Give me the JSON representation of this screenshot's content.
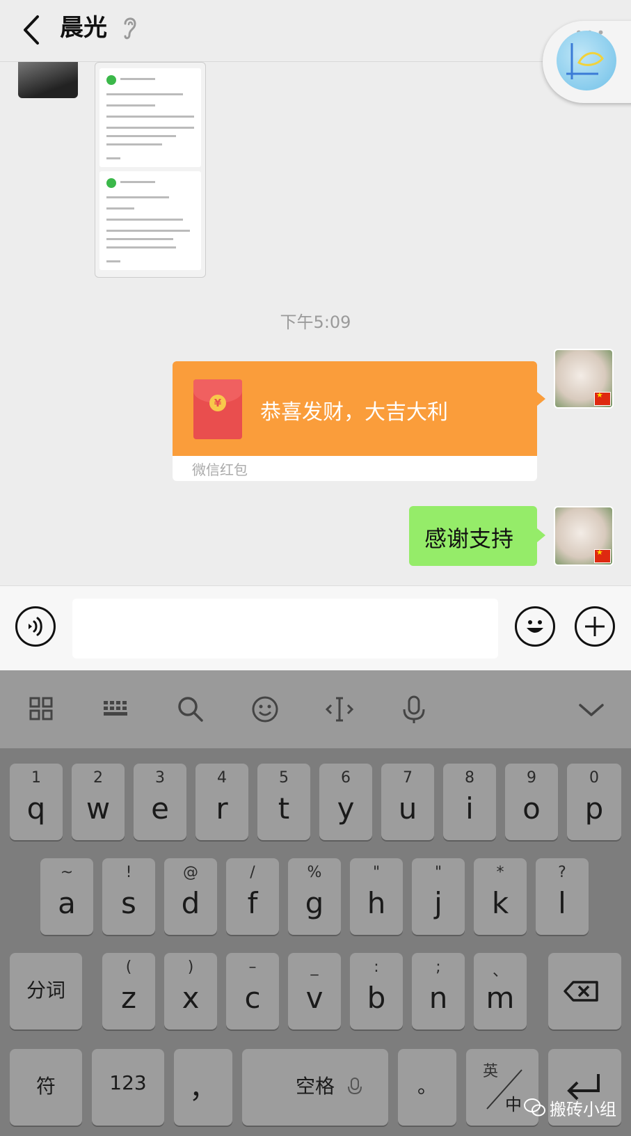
{
  "header": {
    "title": "晨光"
  },
  "chat": {
    "timestamp": "下午5:09",
    "red_packet": {
      "greeting": "恭喜发财，大吉大利",
      "label": "微信红包",
      "coin": "¥"
    },
    "text_message": "感谢支持"
  },
  "input": {
    "value": "",
    "placeholder": ""
  },
  "keyboard": {
    "row1": [
      {
        "sub": "1",
        "main": "q"
      },
      {
        "sub": "2",
        "main": "w"
      },
      {
        "sub": "3",
        "main": "e"
      },
      {
        "sub": "4",
        "main": "r"
      },
      {
        "sub": "5",
        "main": "t"
      },
      {
        "sub": "6",
        "main": "y"
      },
      {
        "sub": "7",
        "main": "u"
      },
      {
        "sub": "8",
        "main": "i"
      },
      {
        "sub": "9",
        "main": "o"
      },
      {
        "sub": "0",
        "main": "p"
      }
    ],
    "row2": [
      {
        "sub": "~",
        "main": "a"
      },
      {
        "sub": "!",
        "main": "s"
      },
      {
        "sub": "@",
        "main": "d"
      },
      {
        "sub": "/",
        "main": "f"
      },
      {
        "sub": "%",
        "main": "g"
      },
      {
        "sub": "\"",
        "main": "h"
      },
      {
        "sub": "\"",
        "main": "j"
      },
      {
        "sub": "*",
        "main": "k"
      },
      {
        "sub": "?",
        "main": "l"
      }
    ],
    "row3_left": "分词",
    "row3": [
      {
        "sub": "(",
        "main": "z"
      },
      {
        "sub": ")",
        "main": "x"
      },
      {
        "sub": "–",
        "main": "c"
      },
      {
        "sub": "_",
        "main": "v"
      },
      {
        "sub": ":",
        "main": "b"
      },
      {
        "sub": ";",
        "main": "n"
      },
      {
        "sub": "、",
        "main": "m"
      }
    ],
    "symbols_label": "符",
    "numbers_label": "123",
    "comma_label": "，",
    "space_label": "空格",
    "period_label": "。",
    "lang_top": "英",
    "lang_bottom": "中"
  },
  "watermark": "搬砖小组",
  "colors": {
    "red_packet": "#fa9d3b",
    "sent_bubble": "#95ec69",
    "keyboard_bg": "#7d7d7d",
    "key_bg": "#9d9d9d"
  },
  "icons": [
    "back-arrow-icon",
    "ear-icon",
    "voice-icon",
    "emoji-icon",
    "plus-icon",
    "grid-icon",
    "keyboard-icon",
    "search-icon",
    "smiley-icon",
    "cursor-icon",
    "mic-icon",
    "chevron-down-icon",
    "backspace-icon",
    "enter-icon"
  ]
}
